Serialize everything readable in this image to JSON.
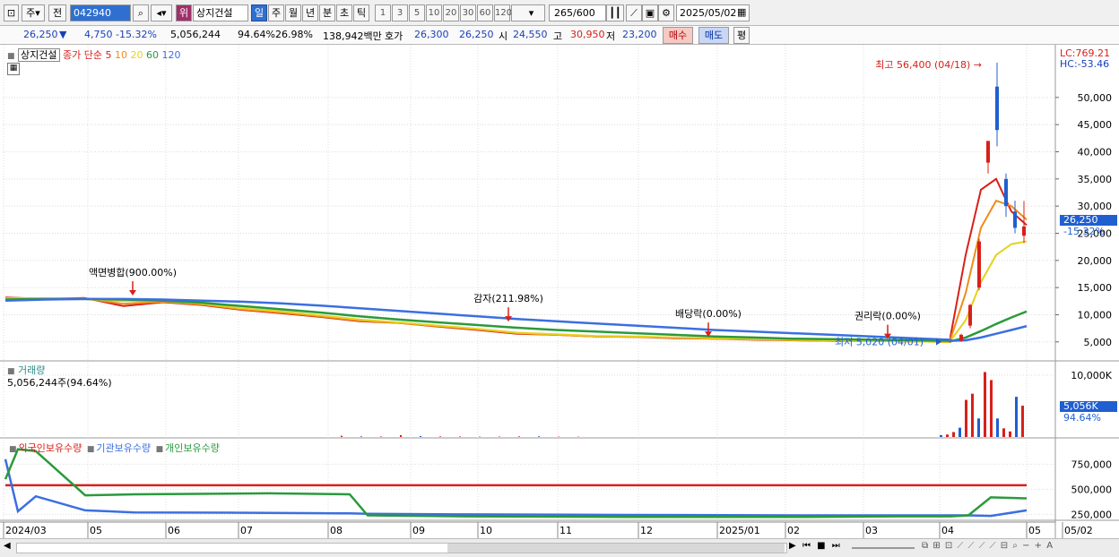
{
  "toolbar": {
    "market_label": "주",
    "prev_label": "전",
    "stock_code": "042940",
    "category_label": "위",
    "stock_name": "상지건설",
    "period_buttons": [
      "일",
      "주",
      "월",
      "년",
      "분",
      "초",
      "틱"
    ],
    "minute_buttons": [
      "1",
      "3",
      "5",
      "10",
      "20",
      "30",
      "60",
      "120"
    ],
    "count_value": "265",
    "count_total": "/600",
    "date_value": "2025/05/02"
  },
  "quote": {
    "price": "26,250",
    "direction": "▼",
    "change": "4,750",
    "change_pct": "-15.32%",
    "volume": "5,056,244",
    "volume_ratio": "94.64%",
    "turnover": "26.98%",
    "amount": "138,942백만",
    "ask_label": "호가",
    "ask": "26,300",
    "bid": "26,250",
    "open_label": "시",
    "open": "24,550",
    "high_label": "고",
    "high": "30,950",
    "low_label": "저",
    "low": "23,200",
    "buy_label": "매수",
    "sell_label": "매도",
    "eval_label": "평"
  },
  "price_panel": {
    "title": "상지건설",
    "legend": [
      {
        "text": "종가 단순 5",
        "color": "#d8201a"
      },
      {
        "text": "10",
        "color": "#f08c1a"
      },
      {
        "text": "20",
        "color": "#e6d21e"
      },
      {
        "text": "60",
        "color": "#2a9a3c"
      },
      {
        "text": "120",
        "color": "#3b6fe0"
      }
    ],
    "lc_label": "LC:769.21",
    "hc_label": "HC:-53.46",
    "current_price_tag": "26,250",
    "current_pct_tag": "-15.32%",
    "high_annotation": "최고 56,400 (04/18)",
    "low_annotation": "최저 5,020 (04/01)",
    "events": [
      {
        "label": "액면병합(900.00%)"
      },
      {
        "label": "감자(211.98%)"
      },
      {
        "label": "배당락(0.00%)"
      },
      {
        "label": "권리락(0.00%)"
      }
    ]
  },
  "volume_panel": {
    "title": "거래량",
    "subtitle": "5,056,244주(94.64%)",
    "tag_value": "5,056K",
    "tag_pct": "94.64%"
  },
  "holding_panel": {
    "legend": [
      {
        "text": "외국인보유수량",
        "color": "#d8201a"
      },
      {
        "text": "기관보유수량",
        "color": "#3b6fe0"
      },
      {
        "text": "개인보유수량",
        "color": "#2a9a3c"
      }
    ]
  },
  "chart_data": [
    {
      "type": "line",
      "title": "상지건설",
      "x": [
        "2024/03",
        "05",
        "06",
        "07",
        "08",
        "09",
        "10",
        "11",
        "12",
        "2025/01",
        "02",
        "03",
        "04",
        "05",
        "05/02"
      ],
      "ylim": [
        0,
        56400
      ],
      "yticks": [
        5000,
        10000,
        15000,
        20000,
        25000,
        30000,
        35000,
        40000,
        45000,
        50000
      ],
      "ytick_labels": [
        "5,000",
        "10,000",
        "15,000",
        "20,000",
        "25,000",
        "30,000",
        "35,000",
        "40,000",
        "45,000",
        "50,000"
      ],
      "series": [
        {
          "name": "종가 단순 5",
          "color": "#d8201a",
          "values": [
            13200,
            12900,
            13100,
            11600,
            12300,
            11800,
            10900,
            10300,
            9600,
            8800,
            8500,
            7800,
            7200,
            6500,
            6300,
            6000,
            5900,
            5700,
            5600,
            5400,
            5300,
            5200,
            5200,
            5100,
            5000,
            6000,
            21000,
            33000,
            35000,
            29000,
            26500
          ]
        },
        {
          "name": "10",
          "color": "#f08c1a",
          "values": [
            13100,
            13000,
            13000,
            12000,
            12400,
            11900,
            11000,
            10400,
            9700,
            8900,
            8500,
            7900,
            7300,
            6600,
            6300,
            6000,
            5900,
            5800,
            5600,
            5500,
            5300,
            5200,
            5200,
            5100,
            5000,
            5500,
            14000,
            26000,
            31000,
            30000,
            27500
          ]
        },
        {
          "name": "20",
          "color": "#e6d21e",
          "values": [
            13000,
            13000,
            12900,
            12500,
            12500,
            12000,
            11200,
            10600,
            9900,
            9100,
            8600,
            8000,
            7400,
            6700,
            6400,
            6100,
            6000,
            5800,
            5700,
            5500,
            5400,
            5300,
            5200,
            5100,
            5000,
            5200,
            9000,
            16000,
            21000,
            23000,
            23500
          ]
        },
        {
          "name": "60",
          "color": "#2a9a3c",
          "values": [
            12800,
            12900,
            12900,
            12800,
            12600,
            12200,
            11600,
            11000,
            10400,
            9700,
            9100,
            8600,
            8100,
            7600,
            7200,
            6900,
            6600,
            6300,
            6000,
            5800,
            5600,
            5500,
            5400,
            5300,
            5200,
            5100,
            5800,
            7000,
            8300,
            9500,
            10600
          ]
        },
        {
          "name": "120",
          "color": "#3b6fe0",
          "values": [
            12600,
            12800,
            12900,
            12900,
            12800,
            12600,
            12400,
            12100,
            11700,
            11200,
            10700,
            10200,
            9700,
            9200,
            8800,
            8400,
            8000,
            7600,
            7200,
            6900,
            6600,
            6300,
            6000,
            5700,
            5400,
            5200,
            5300,
            5800,
            6500,
            7200,
            7900
          ]
        }
      ],
      "candles_late": [
        {
          "o": 5200,
          "h": 6500,
          "l": 5000,
          "c": 6300
        },
        {
          "o": 8000,
          "h": 12000,
          "l": 7500,
          "c": 11800
        },
        {
          "o": 15000,
          "h": 24000,
          "l": 14500,
          "c": 23500
        },
        {
          "o": 38000,
          "h": 42000,
          "l": 36000,
          "c": 42000
        },
        {
          "o": 52000,
          "h": 56400,
          "l": 41000,
          "c": 44000
        },
        {
          "o": 35000,
          "h": 36000,
          "l": 28000,
          "c": 30000
        },
        {
          "o": 29000,
          "h": 31000,
          "l": 25000,
          "c": 26000
        },
        {
          "o": 24550,
          "h": 30950,
          "l": 23200,
          "c": 26250
        }
      ]
    },
    {
      "type": "bar",
      "title": "거래량",
      "ylim": [
        0,
        11000000
      ],
      "yticks": [
        10000000
      ],
      "ytick_labels": [
        "10,000K"
      ],
      "values": [
        200000,
        100000,
        80000,
        300000,
        150000,
        90000,
        80000,
        60000,
        70000,
        100000,
        120000,
        60000,
        50000,
        300000,
        400000,
        800000,
        1500000,
        6000000,
        7000000,
        3000000,
        10500000,
        9200000,
        3000000,
        1400000,
        900000,
        6500000,
        5056244
      ]
    },
    {
      "type": "line",
      "ylim": [
        200000,
        950000
      ],
      "yticks": [
        250000,
        500000,
        750000
      ],
      "ytick_labels": [
        "250,000",
        "500,000",
        "750,000"
      ],
      "series": [
        {
          "name": "외국인보유수량",
          "color": "#d8201a",
          "values": [
            540000,
            540000,
            540000,
            540000,
            540000,
            540000,
            540000,
            540000,
            540000,
            540000,
            540000,
            540000,
            540000,
            540000,
            540000,
            540000
          ]
        },
        {
          "name": "기관보유수량",
          "color": "#3b6fe0",
          "values": [
            800000,
            280000,
            430000,
            290000,
            270000,
            265000,
            260000,
            255000,
            250000,
            245000,
            240000,
            240000,
            240000,
            240000,
            235000,
            290000
          ]
        },
        {
          "name": "개인보유수량",
          "color": "#2a9a3c",
          "values": [
            600000,
            900000,
            880000,
            440000,
            450000,
            460000,
            450000,
            240000,
            230000,
            225000,
            225000,
            230000,
            230000,
            240000,
            420000,
            410000
          ]
        }
      ]
    }
  ]
}
